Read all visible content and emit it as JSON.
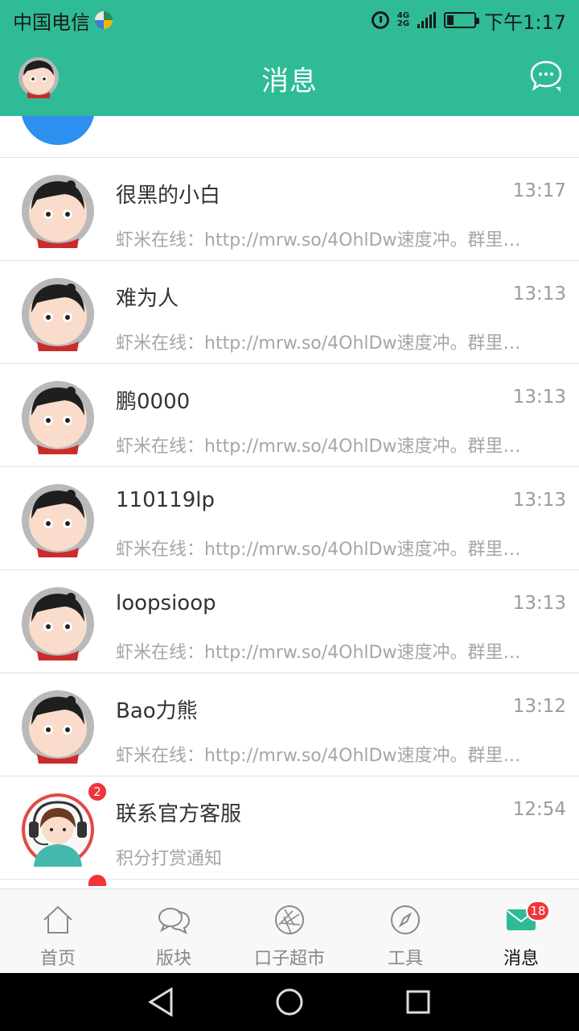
{
  "status_bar": {
    "carrier": "中国电信",
    "network": [
      "4G",
      "2G"
    ],
    "time": "下午1:17",
    "battery_level": 0.25
  },
  "header": {
    "title": "消息",
    "avatar_icon": "cartoon-avatar-icon",
    "compose_icon": "chat-bubble-icon"
  },
  "conversations": [
    {
      "name": "很黑的小白",
      "time": "13:17",
      "preview": "虾米在线：http://mrw.so/4OhlDw速度冲。群里…"
    },
    {
      "name": "难为人",
      "time": "13:13",
      "preview": "虾米在线：http://mrw.so/4OhlDw速度冲。群里…"
    },
    {
      "name": "鹏0000",
      "time": "13:13",
      "preview": "虾米在线：http://mrw.so/4OhlDw速度冲。群里…"
    },
    {
      "name": "110119lp",
      "time": "13:13",
      "preview": "虾米在线：http://mrw.so/4OhlDw速度冲。群里…"
    },
    {
      "name": "loopsioop",
      "time": "13:13",
      "preview": "虾米在线：http://mrw.so/4OhlDw速度冲。群里…"
    },
    {
      "name": "Bao力熊",
      "time": "13:12",
      "preview": "虾米在线：http://mrw.so/4OhlDw速度冲。群里…"
    },
    {
      "name": "联系官方客服",
      "time": "12:54",
      "preview": "积分打赏通知",
      "badge": "2"
    }
  ],
  "tabs": [
    {
      "label": "首页",
      "icon": "home-icon"
    },
    {
      "label": "版块",
      "icon": "chat-bubbles-icon"
    },
    {
      "label": "口子超市",
      "icon": "aperture-icon"
    },
    {
      "label": "工具",
      "icon": "compass-icon"
    },
    {
      "label": "消息",
      "icon": "mail-icon",
      "badge": "18",
      "active": true
    }
  ],
  "colors": {
    "brand": "#2fbb96",
    "badge": "#f0353b",
    "preview_text": "#a6a6a6"
  }
}
